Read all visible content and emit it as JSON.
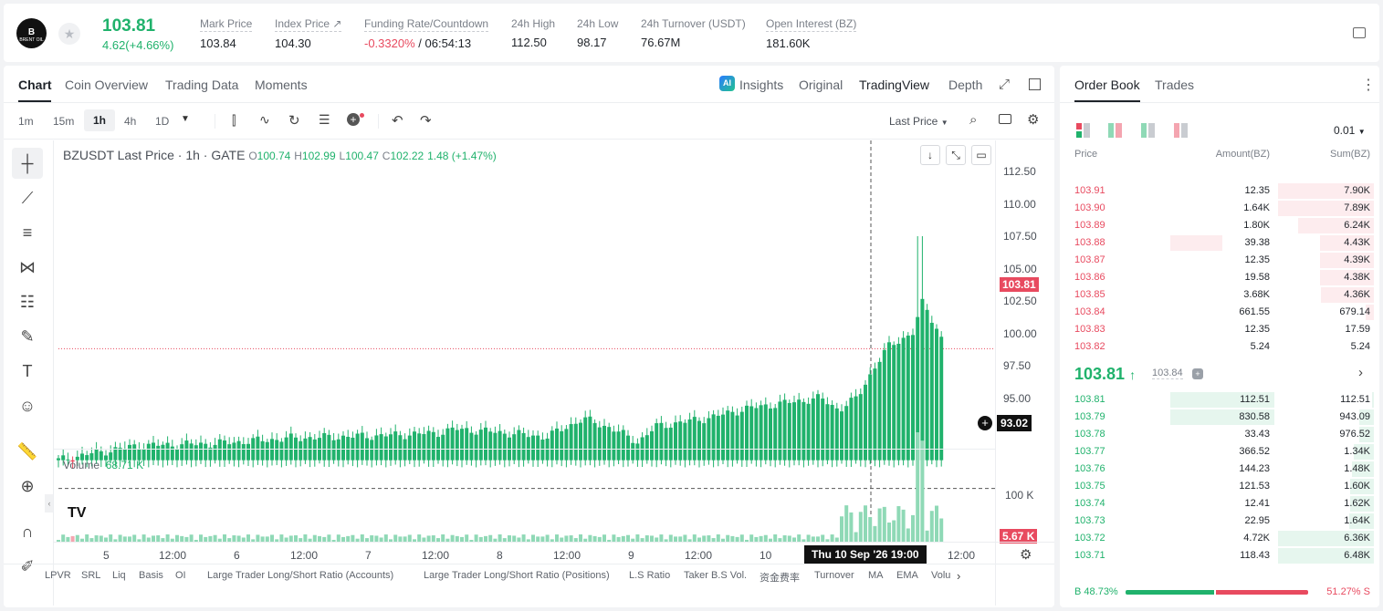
{
  "ticker": {
    "logo_text": "BRENT OIL",
    "price": "103.81",
    "change": "4.62(+4.66%)",
    "stats": [
      {
        "label": "Mark Price",
        "value": "103.84"
      },
      {
        "label": "Index Price ↗",
        "value": "104.30"
      },
      {
        "label": "Funding Rate/Countdown",
        "value_rate": "-0.3320%",
        "value_countdown": "/ 06:54:13"
      },
      {
        "label": "24h High",
        "value": "112.50"
      },
      {
        "label": "24h Low",
        "value": "98.17"
      },
      {
        "label": "24h Turnover (USDT)",
        "value": "76.67M"
      },
      {
        "label": "Open Interest (BZ)",
        "value": "181.60K"
      }
    ]
  },
  "chart_tabs": [
    "Chart",
    "Coin Overview",
    "Trading Data",
    "Moments"
  ],
  "view_tabs": {
    "insights": "Insights",
    "original": "Original",
    "tradingview": "TradingView",
    "depth": "Depth"
  },
  "intervals": [
    "1m",
    "15m",
    "1h",
    "4h",
    "1D"
  ],
  "selected_interval": "1h",
  "last_price_select": "Last Price",
  "legend": {
    "symbol": "BZUSDT Last Price · 1h · GATE",
    "o_k": "O",
    "o": "100.74",
    "h_k": "H",
    "h": "102.99",
    "l_k": "L",
    "l": "100.47",
    "c_k": "C",
    "c": "102.22",
    "chg": "1.48 (+1.47%)"
  },
  "volume_legend": {
    "label": "Volume",
    "value": "68.71 K"
  },
  "price_axis": [
    "112.50",
    "110.00",
    "107.50",
    "105.00",
    "102.50",
    "100.00",
    "97.50",
    "95.00"
  ],
  "volume_axis": "100 K",
  "current_price_tag": "103.81",
  "crosshair_price_tag": "93.02",
  "volume_tag": "5.67 K",
  "time_axis": [
    "5",
    "12:00",
    "6",
    "12:00",
    "7",
    "12:00",
    "8",
    "12:00",
    "9",
    "12:00",
    "10",
    "12:00"
  ],
  "crosshair_time": "Thu 10 Sep '26   19:00",
  "bottom_indicators": [
    "LPVR",
    "SRL",
    "Liq",
    "Basis",
    "OI",
    "Large Trader Long/Short Ratio (Accounts)",
    "Large Trader Long/Short Ratio (Positions)",
    "L.S Ratio",
    "Taker B.S Vol.",
    "资金费率",
    "Turnover",
    "MA",
    "EMA",
    "Volu"
  ],
  "colors": {
    "up": "#20b26c",
    "down": "#e84a5f",
    "up_bg": "#e6f6ee",
    "down_bg": "#fdecee"
  },
  "orderbook": {
    "tabs": [
      "Order Book",
      "Trades"
    ],
    "precision": "0.01",
    "headers": {
      "price": "Price",
      "amount": "Amount(BZ)",
      "sum": "Sum(BZ)"
    },
    "asks": [
      {
        "price": "103.91",
        "amount": "12.35",
        "sum": "7.90K",
        "depth": 1.0,
        "amt_depth": 0
      },
      {
        "price": "103.90",
        "amount": "1.64K",
        "sum": "7.89K",
        "depth": 1.0,
        "amt_depth": 0
      },
      {
        "price": "103.89",
        "amount": "1.80K",
        "sum": "6.24K",
        "depth": 0.79,
        "amt_depth": 0
      },
      {
        "price": "103.88",
        "amount": "39.38",
        "sum": "4.43K",
        "depth": 0.56,
        "amt_depth": 0.5
      },
      {
        "price": "103.87",
        "amount": "12.35",
        "sum": "4.39K",
        "depth": 0.56,
        "amt_depth": 0
      },
      {
        "price": "103.86",
        "amount": "19.58",
        "sum": "4.38K",
        "depth": 0.56,
        "amt_depth": 0
      },
      {
        "price": "103.85",
        "amount": "3.68K",
        "sum": "4.36K",
        "depth": 0.55,
        "amt_depth": 0
      },
      {
        "price": "103.84",
        "amount": "661.55",
        "sum": "679.14",
        "depth": 0.09,
        "amt_depth": 0
      },
      {
        "price": "103.83",
        "amount": "12.35",
        "sum": "17.59",
        "depth": 0,
        "amt_depth": 0
      },
      {
        "price": "103.82",
        "amount": "5.24",
        "sum": "5.24",
        "depth": 0,
        "amt_depth": 0
      }
    ],
    "last": {
      "price": "103.81",
      "arrow": "↑",
      "mark": "103.84"
    },
    "bids": [
      {
        "price": "103.81",
        "amount": "112.51",
        "sum": "112.51",
        "depth": 0.02,
        "amt_depth": 1.0
      },
      {
        "price": "103.79",
        "amount": "830.58",
        "sum": "943.09",
        "depth": 0.15,
        "amt_depth": 1.0
      },
      {
        "price": "103.78",
        "amount": "33.43",
        "sum": "976.52",
        "depth": 0.15,
        "amt_depth": 0
      },
      {
        "price": "103.77",
        "amount": "366.52",
        "sum": "1.34K",
        "depth": 0.21,
        "amt_depth": 0
      },
      {
        "price": "103.76",
        "amount": "144.23",
        "sum": "1.48K",
        "depth": 0.23,
        "amt_depth": 0
      },
      {
        "price": "103.75",
        "amount": "121.53",
        "sum": "1.60K",
        "depth": 0.25,
        "amt_depth": 0
      },
      {
        "price": "103.74",
        "amount": "12.41",
        "sum": "1.62K",
        "depth": 0.25,
        "amt_depth": 0
      },
      {
        "price": "103.73",
        "amount": "22.95",
        "sum": "1.64K",
        "depth": 0.26,
        "amt_depth": 0
      },
      {
        "price": "103.72",
        "amount": "4.72K",
        "sum": "6.36K",
        "depth": 1.0,
        "amt_depth": 0
      },
      {
        "price": "103.71",
        "amount": "118.43",
        "sum": "6.48K",
        "depth": 1.0,
        "amt_depth": 0
      }
    ],
    "ratio": {
      "buy_label": "B",
      "buy": "48.73%",
      "sell": "51.27%",
      "sell_label": "S",
      "buy_fraction": 0.4873
    }
  }
}
